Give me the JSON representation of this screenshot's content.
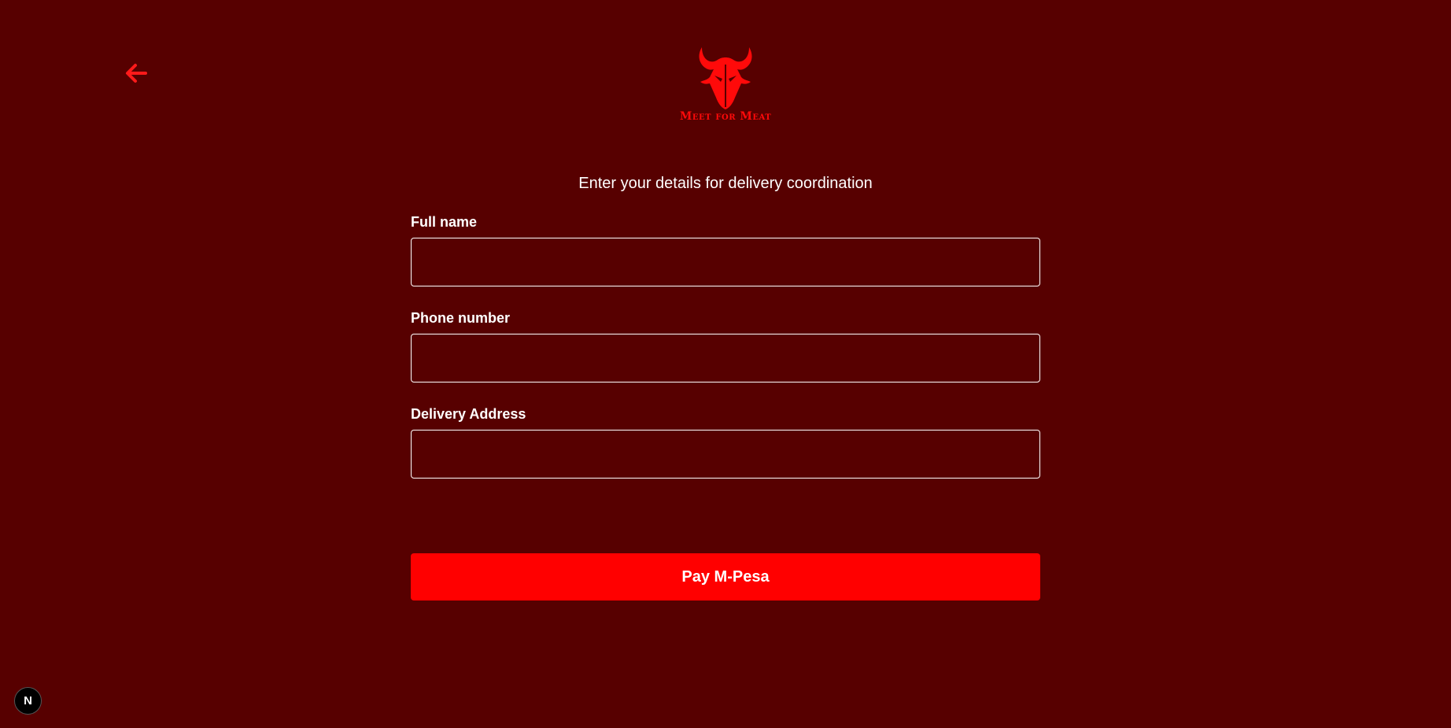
{
  "header": {
    "back_icon": "arrow-left-icon",
    "logo_icon": "bull-head-icon",
    "logo_text": "Meet for Meat"
  },
  "form": {
    "subtitle": "Enter your details for delivery coordination",
    "fields": [
      {
        "label": "Full name",
        "value": "",
        "placeholder": ""
      },
      {
        "label": "Phone number",
        "value": "",
        "placeholder": ""
      },
      {
        "label": "Delivery Address",
        "value": "",
        "placeholder": ""
      }
    ],
    "submit_label": "Pay M-Pesa"
  },
  "dev_badge": {
    "icon": "nextjs-icon",
    "label": "N"
  },
  "colors": {
    "background": "#570000",
    "accent": "#ff0000",
    "text": "#ffffff"
  }
}
